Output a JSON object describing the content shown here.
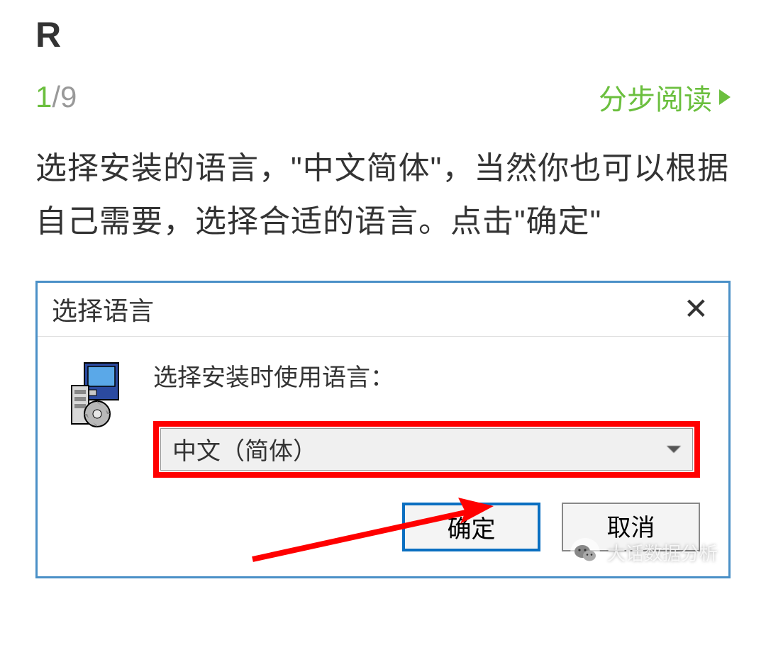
{
  "section": {
    "title": "R"
  },
  "pagination": {
    "current": "1",
    "sep": "/",
    "total": "9"
  },
  "navigation": {
    "step_read_label": "分步阅读"
  },
  "description": "选择安装的语言，\"中文简体\"，当然你也可以根据自己需要，选择合适的语言。点击\"确定\"",
  "dialog": {
    "title": "选择语言",
    "prompt": "选择安装时使用语言：",
    "dropdown_value": "中文（简体）",
    "ok_label": "确定",
    "cancel_label": "取消"
  },
  "watermark": {
    "text": "大话数据分析"
  }
}
